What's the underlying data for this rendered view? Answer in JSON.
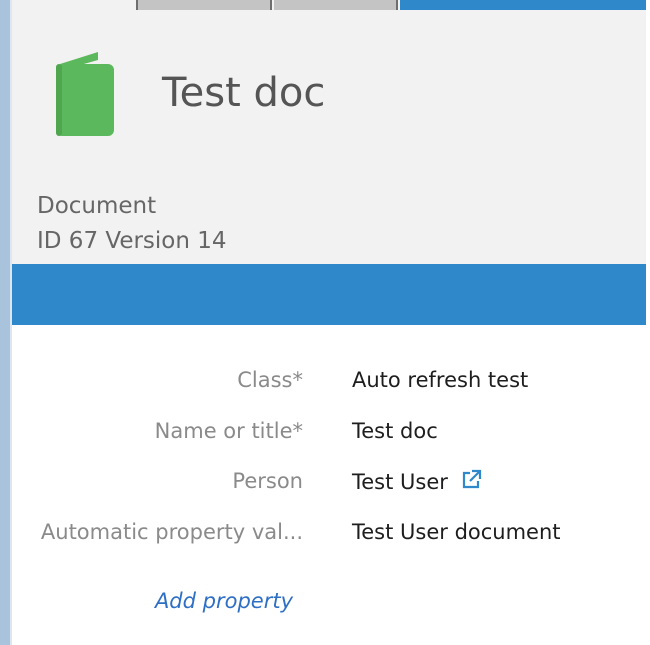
{
  "header": {
    "title": "Test doc",
    "object_type": "Document",
    "id_line": "ID 67  Version 14",
    "icon": "green-book-icon"
  },
  "properties": [
    {
      "label": "Class*",
      "value": "Auto refresh test"
    },
    {
      "label": "Name or title*",
      "value": "Test doc"
    },
    {
      "label": "Person",
      "value": "Test User",
      "link_icon": "external-link-icon"
    },
    {
      "label": "Automatic property val...",
      "value": "Test User document"
    }
  ],
  "add_property_label": "Add property",
  "colors": {
    "accent_blue": "#2e88c9",
    "icon_green": "#5cb85c",
    "link_blue": "#2e6fc4"
  }
}
